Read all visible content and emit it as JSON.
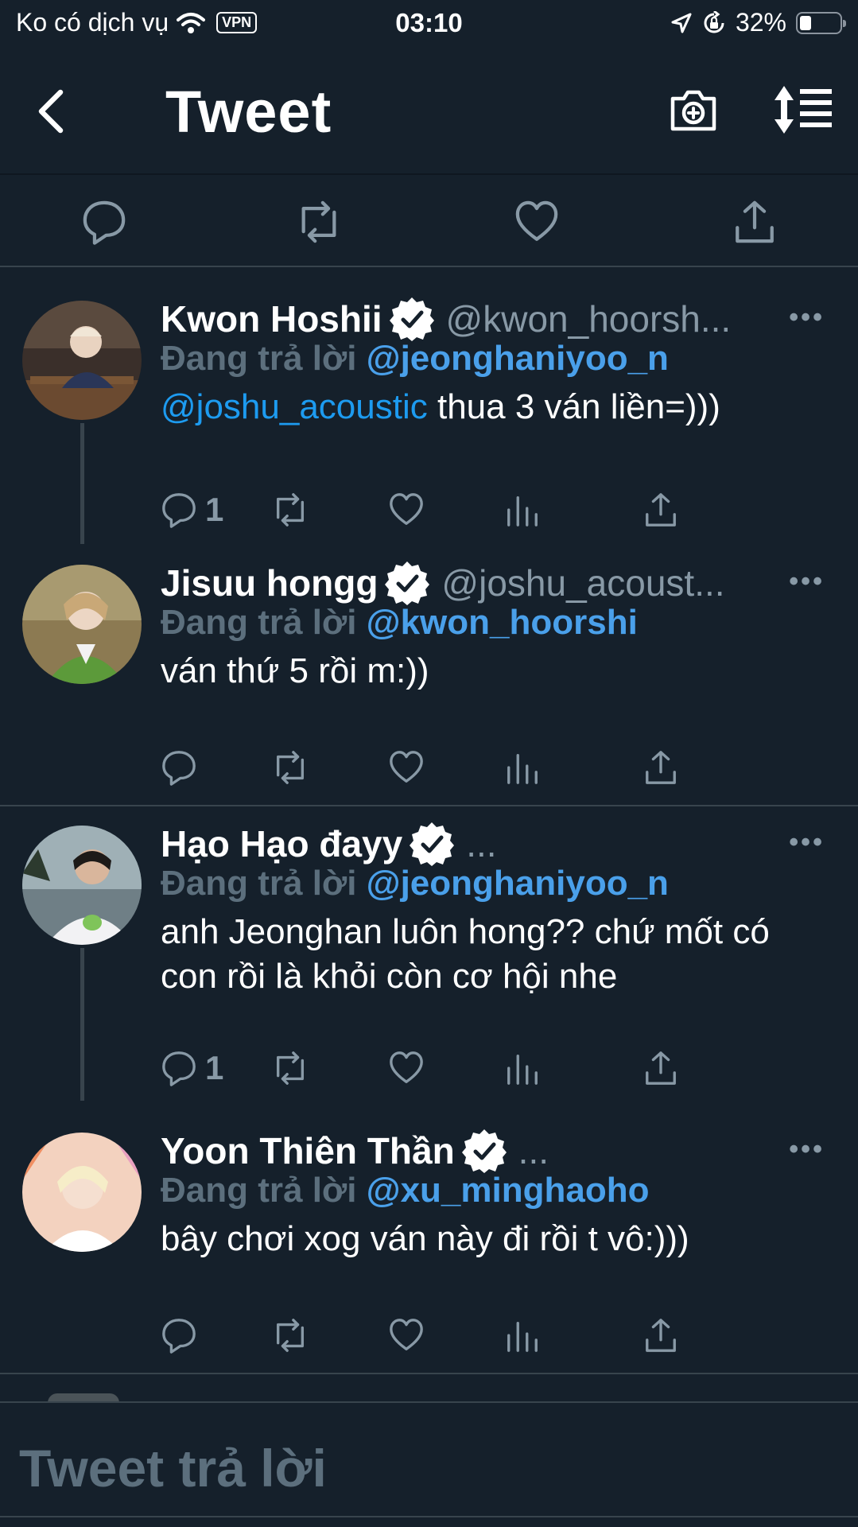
{
  "status_bar": {
    "carrier": "Ko có dịch vụ",
    "vpn": "VPN",
    "time": "03:10",
    "battery": "32%"
  },
  "nav": {
    "title": "Tweet",
    "back_icon": "chevron-left-icon",
    "camera_icon": "camera-plus-icon",
    "sort_icon": "sort-icon"
  },
  "colors": {
    "background": "#15202b",
    "accent": "#1d9bf0",
    "muted": "#8899a6",
    "divider": "#38444d"
  },
  "tweets": [
    {
      "name": "Kwon Hoshii",
      "handle": "@kwon_hoorsh...",
      "reply_prefix": "Đang trả lời",
      "reply_to": "@jeonghaniyoo_n",
      "mention": "@joshu_acoustic",
      "text": " thua 3 ván liền=)))",
      "reply_count": "1"
    },
    {
      "name": "Jisuu hongg",
      "handle": "@joshu_acoust...",
      "reply_prefix": "Đang trả lời",
      "reply_to": "@kwon_hoorshi",
      "text": "ván thứ 5 rồi m:))"
    },
    {
      "name": "Hạo Hạo đayy",
      "handle": "...",
      "reply_prefix": "Đang trả lời",
      "reply_to": "@jeonghaniyoo_n",
      "text": "anh Jeonghan luôn hong?? chứ mốt có con rồi là khỏi còn cơ hội nhe",
      "reply_count": "1"
    },
    {
      "name": "Yoon Thiên Thần",
      "handle": "...",
      "reply_prefix": "Đang trả lời",
      "reply_to": "@xu_minghaoho",
      "text": "bây chơi xog ván này đi rồi t vô:)))"
    }
  ],
  "compose": {
    "placeholder": "Tweet trả lời"
  }
}
